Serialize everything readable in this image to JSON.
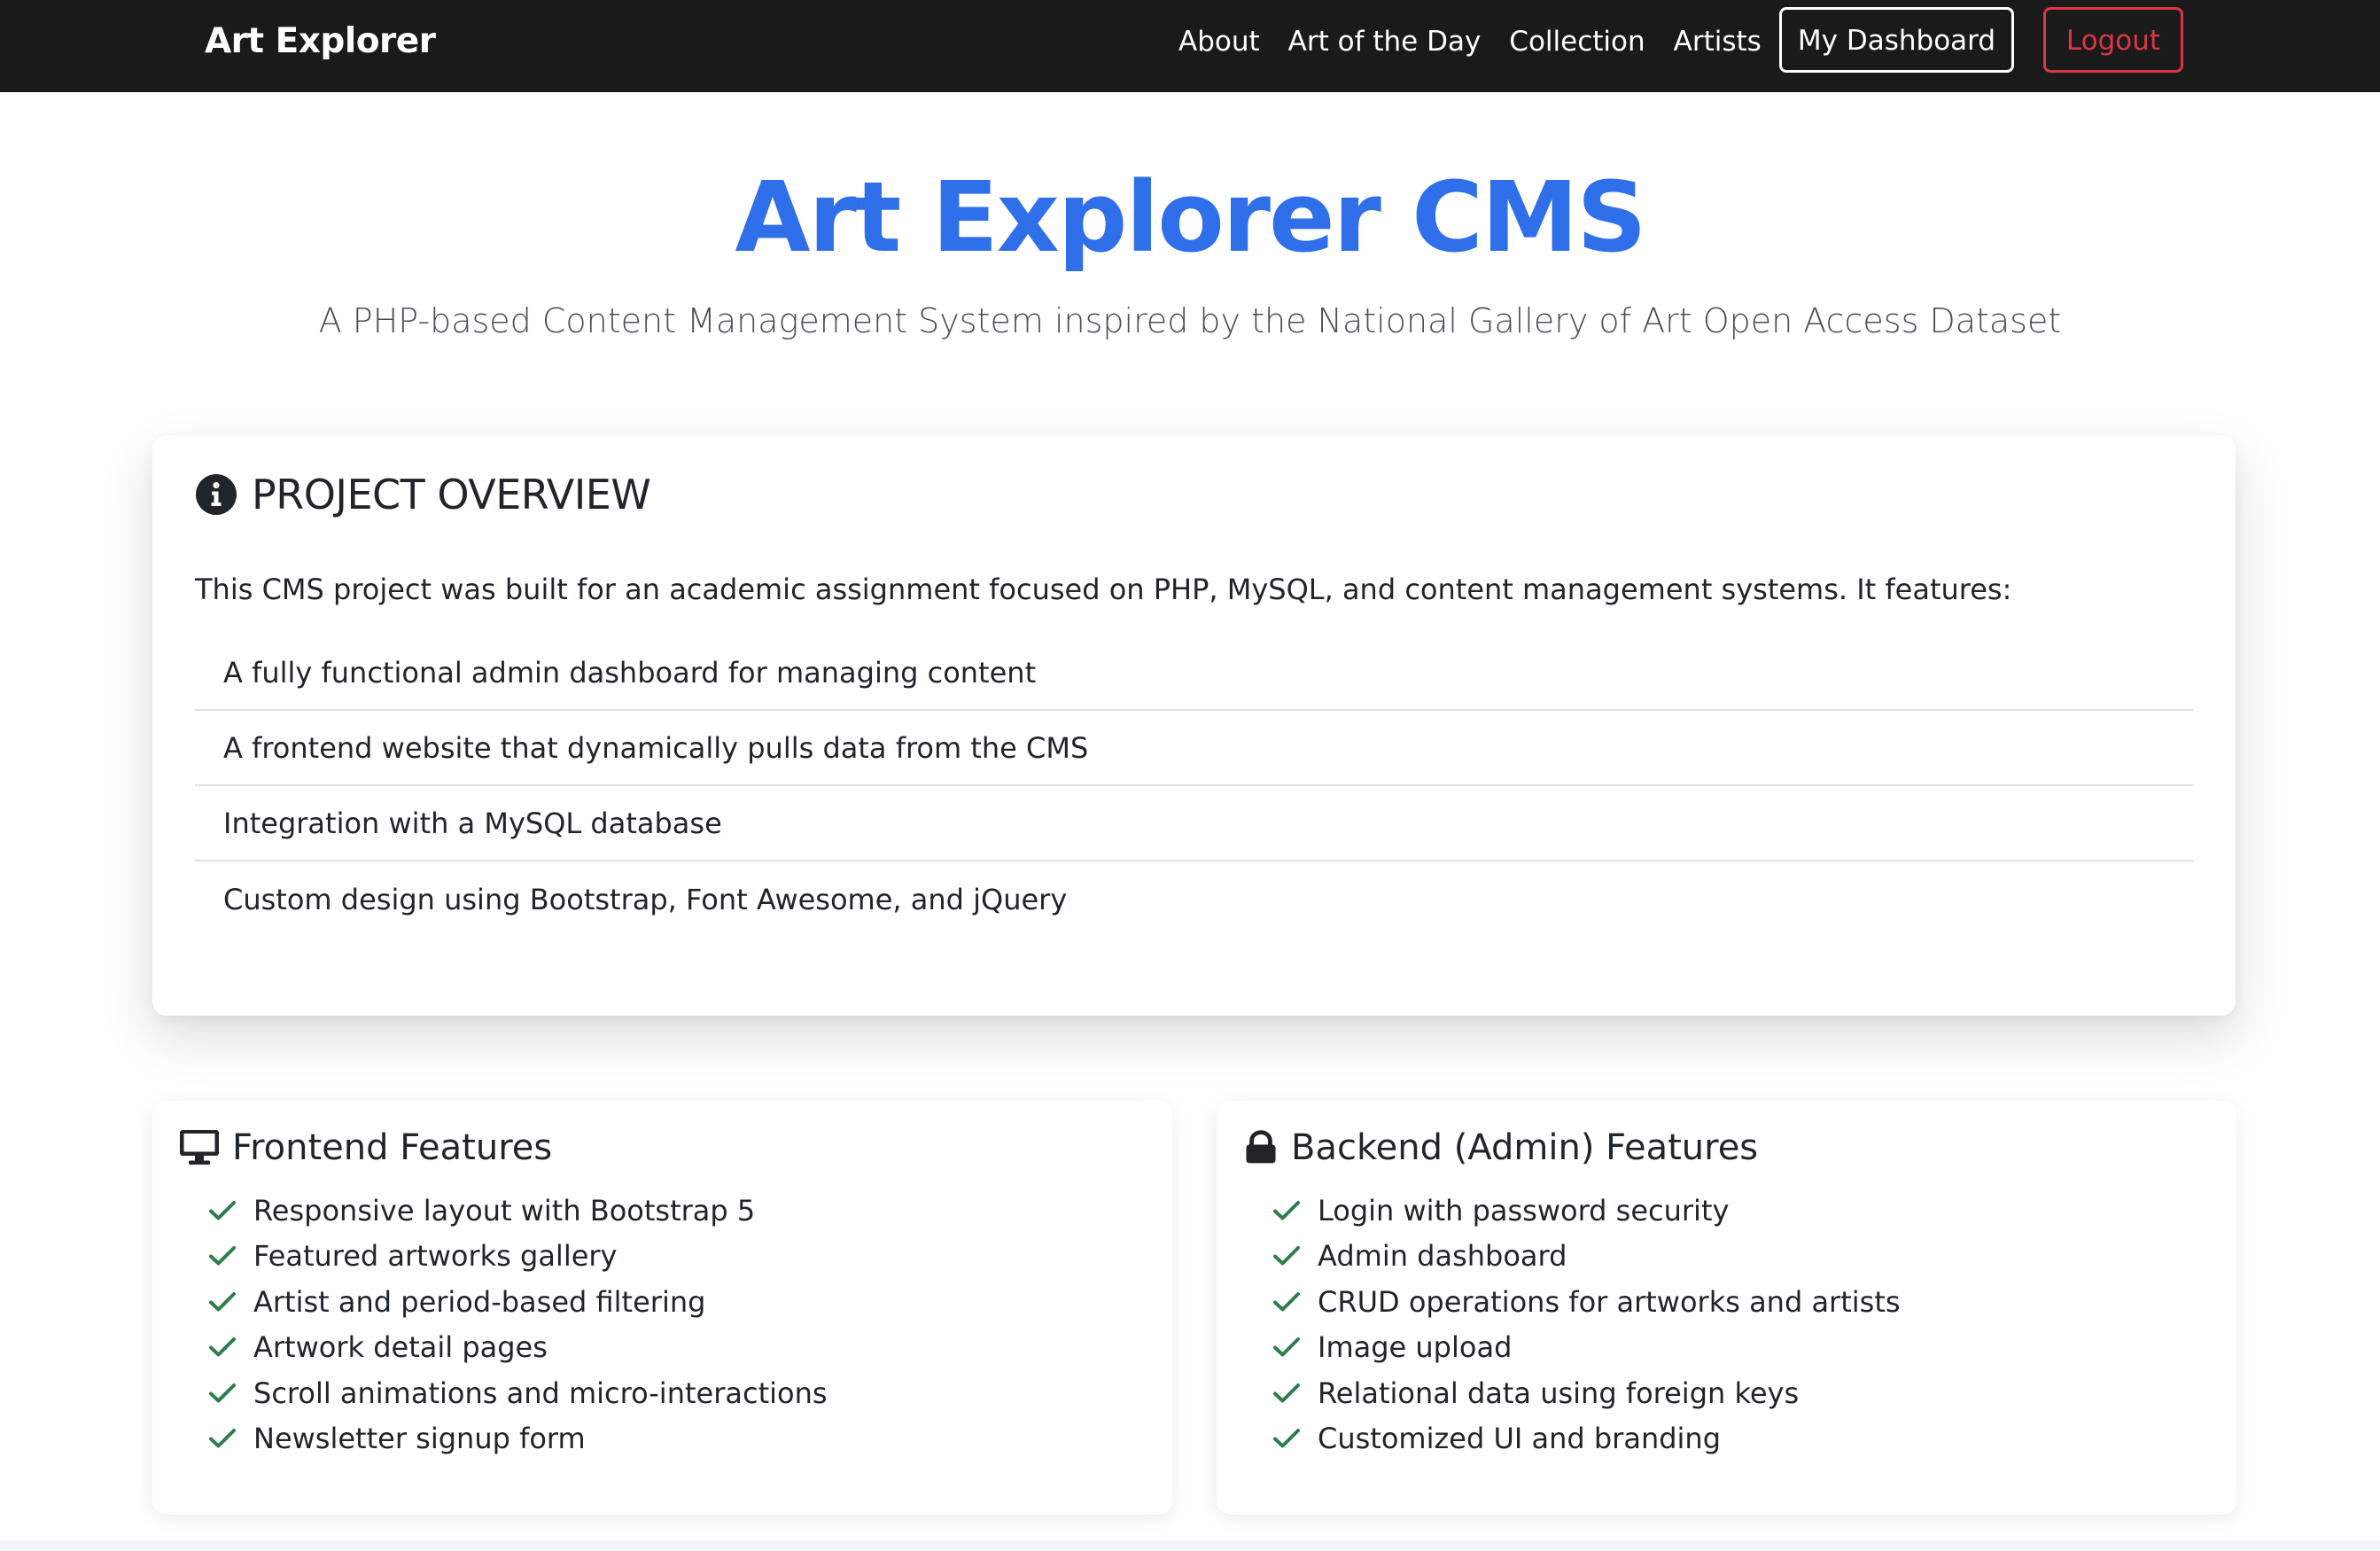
{
  "navbar": {
    "brand": "Art Explorer",
    "links": [
      {
        "label": "About"
      },
      {
        "label": "Art of the Day"
      },
      {
        "label": "Collection"
      },
      {
        "label": "Artists"
      }
    ],
    "dashboard_button": "My Dashboard",
    "logout_button": "Logout"
  },
  "hero": {
    "title": "Art Explorer CMS",
    "subtitle": "A PHP-based Content Management System inspired by the National Gallery of Art Open Access Dataset"
  },
  "overview": {
    "icon": "info-circle-icon",
    "heading": "PROJECT OVERVIEW",
    "intro": "This CMS project was built for an academic assignment focused on PHP, MySQL, and content management systems. It features:",
    "items": [
      "A fully functional admin dashboard for managing content",
      "A frontend website that dynamically pulls data from the CMS",
      "Integration with a MySQL database",
      "Custom design using Bootstrap, Font Awesome, and jQuery"
    ]
  },
  "frontend_features": {
    "icon": "desktop-icon",
    "heading": "Frontend Features",
    "items": [
      "Responsive layout with Bootstrap 5",
      "Featured artworks gallery",
      "Artist and period-based filtering",
      "Artwork detail pages",
      "Scroll animations and micro-interactions",
      "Newsletter signup form"
    ]
  },
  "backend_features": {
    "icon": "lock-icon",
    "heading": "Backend (Admin) Features",
    "items": [
      "Login with password security",
      "Admin dashboard",
      "CRUD operations for artworks and artists",
      "Image upload",
      "Relational data using foreign keys",
      "Customized UI and branding"
    ]
  },
  "colors": {
    "navbar_bg": "#1a1a1a",
    "title_blue": "#2f6fea",
    "logout_red": "#dc3545",
    "check_green": "#2e7d4f"
  }
}
